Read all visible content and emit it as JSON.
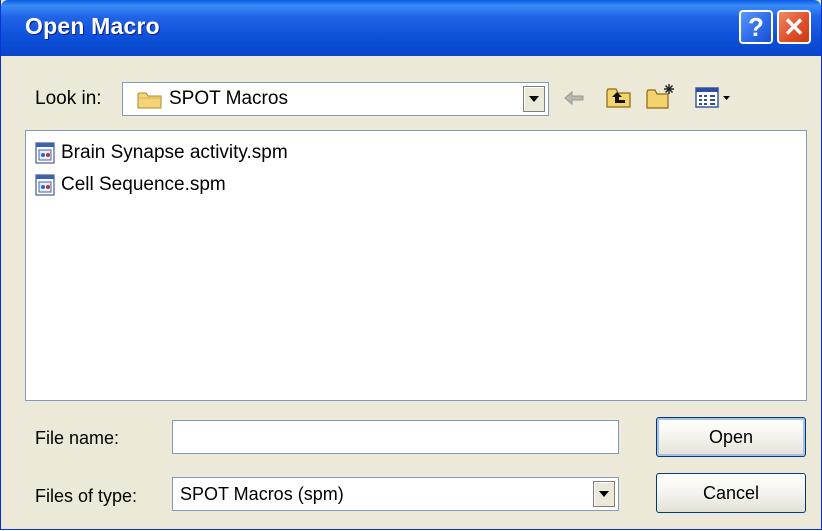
{
  "window": {
    "title": "Open Macro",
    "help_symbol": "?",
    "close_symbol": "✕"
  },
  "look_in": {
    "label": "Look in:",
    "value": "SPOT Macros",
    "icon": "folder-icon"
  },
  "toolbar": {
    "icons": [
      "back-arrow-icon",
      "up-one-level-icon",
      "create-new-folder-icon",
      "view-menu-icon"
    ]
  },
  "files": [
    {
      "name": "Brain Synapse activity.spm",
      "icon": "macro-file-icon"
    },
    {
      "name": "Cell Sequence.spm",
      "icon": "macro-file-icon"
    }
  ],
  "file_name": {
    "label": "File name:",
    "value": "",
    "placeholder": ""
  },
  "files_of_type": {
    "label": "Files of type:",
    "value": "SPOT Macros (spm)"
  },
  "buttons": {
    "open": "Open",
    "cancel": "Cancel"
  },
  "colors": {
    "titlebar": "#0b4fd8",
    "dialog_bg": "#ece9d8",
    "close_button": "#e2502a",
    "help_button": "#2a68e8"
  }
}
